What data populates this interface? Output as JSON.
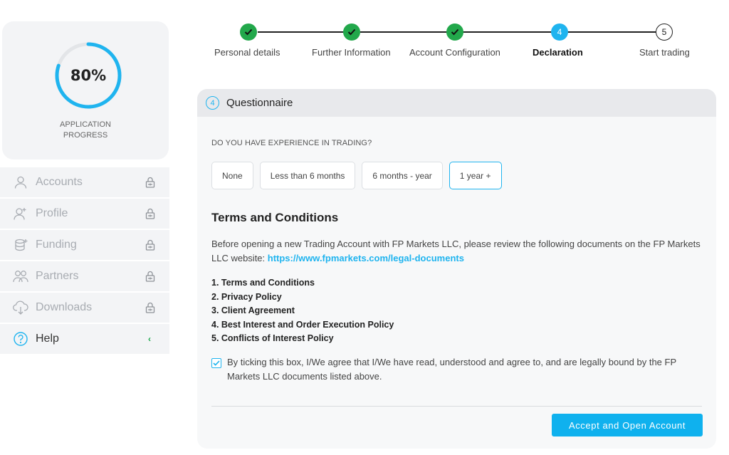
{
  "progress": {
    "percent_text": "80%",
    "percent_value": 0.8,
    "caption_line1": "APPLICATION",
    "caption_line2": "PROGRESS"
  },
  "sidebar": {
    "items": [
      {
        "label": "Accounts",
        "icon": "user-icon",
        "locked": true
      },
      {
        "label": "Profile",
        "icon": "user-plus-icon",
        "locked": true
      },
      {
        "label": "Funding",
        "icon": "funding-icon",
        "locked": true
      },
      {
        "label": "Partners",
        "icon": "partners-icon",
        "locked": true
      },
      {
        "label": "Downloads",
        "icon": "cloud-download-icon",
        "locked": true
      },
      {
        "label": "Help",
        "icon": "help-icon",
        "locked": false
      }
    ]
  },
  "stepper": {
    "steps": [
      {
        "label": "Personal details",
        "status": "done"
      },
      {
        "label": "Further Information",
        "status": "done"
      },
      {
        "label": "Account Configuration",
        "status": "done"
      },
      {
        "label": "Declaration",
        "status": "active",
        "number": "4"
      },
      {
        "label": "Start trading",
        "status": "future",
        "number": "5"
      }
    ]
  },
  "panel": {
    "section_number": "4",
    "title": "Questionnaire",
    "question": "DO YOU HAVE EXPERIENCE IN TRADING?",
    "options": [
      "None",
      "Less than 6 months",
      "6 months - year",
      "1 year +"
    ],
    "selected_option": "1 year +",
    "terms_heading": "Terms and Conditions",
    "terms_intro": "Before opening a new Trading Account with FP Markets LLC, please review the following documents on the FP Markets LLC website: ",
    "terms_link": "https://www.fpmarkets.com/legal-documents",
    "documents": [
      "1. Terms and Conditions",
      "2. Privacy Policy",
      "3. Client Agreement",
      "4. Best Interest and Order Execution Policy",
      "5. Conflicts of Interest Policy"
    ],
    "agree_checked": true,
    "agree_text": "By ticking this box, I/We agree that I/We have read, understood and agree to, and are legally bound by the FP Markets LLC documents listed above.",
    "submit_label": "Accept and Open Account"
  },
  "colors": {
    "accent": "#1fb4ef",
    "done": "#22a84b",
    "muted": "#a8acb2"
  }
}
